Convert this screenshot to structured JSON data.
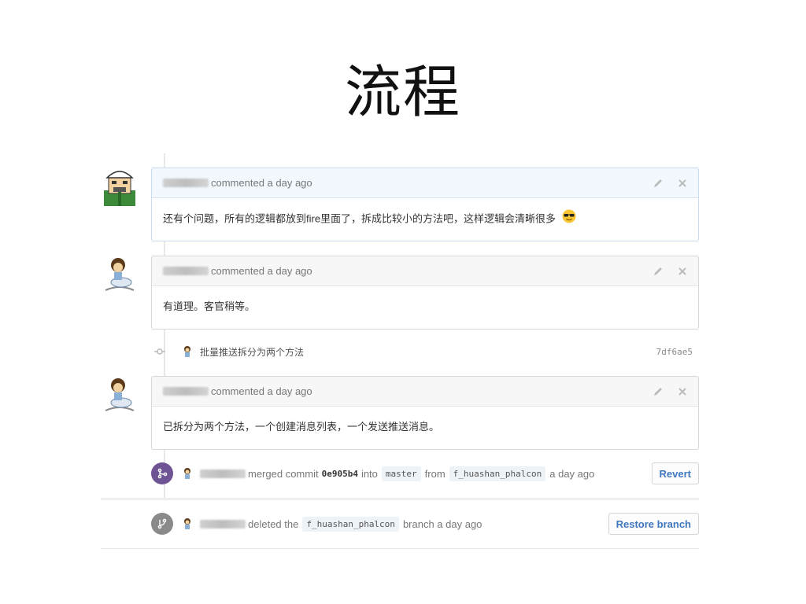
{
  "slide": {
    "title": "流程"
  },
  "comments": [
    {
      "action": "commented a day ago",
      "body": "还有个问题，所有的逻辑都放到fire里面了，拆成比较小的方法吧，这样逻辑会清晰很多"
    },
    {
      "action": "commented a day ago",
      "body": "有道理。客官稍等。"
    },
    {
      "action": "commented a day ago",
      "body": "已拆分为两个方法，一个创建消息列表，一个发送推送消息。"
    }
  ],
  "commit": {
    "message": "批量推送拆分为两个方法",
    "sha": "7df6ae5"
  },
  "merge_event": {
    "verb": "merged commit",
    "commit_sha": "0e905b4",
    "into": "into",
    "target_branch": "master",
    "from": "from",
    "source_branch": "f_huashan_phalcon",
    "time": "a day ago",
    "button": "Revert"
  },
  "delete_event": {
    "verb": "deleted the",
    "branch": "f_huashan_phalcon",
    "suffix": "branch a day ago",
    "button": "Restore branch"
  },
  "colors": {
    "merged_badge": "#6e5494",
    "deleted_badge": "#8a8a8a",
    "link": "#4078c0"
  },
  "icons": [
    "pencil-icon",
    "close-icon",
    "commit-icon",
    "merge-icon",
    "branch-icon",
    "sunglasses-emoji"
  ]
}
